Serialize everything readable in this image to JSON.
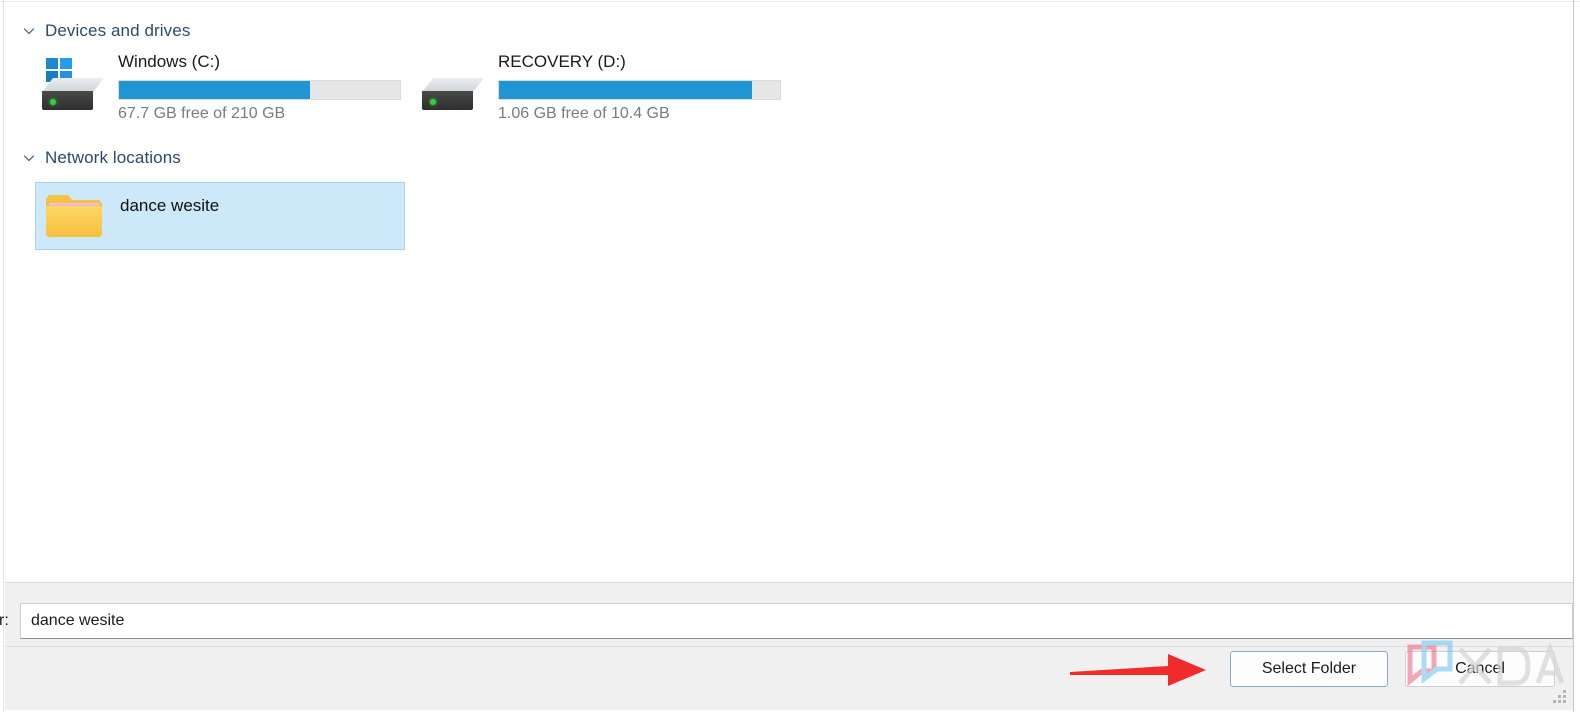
{
  "dialog": {
    "groups": [
      {
        "id": "devices",
        "label": "Devices and drives",
        "chevron_icon": "chevron-down-icon",
        "expanded": true
      },
      {
        "id": "network",
        "label": "Network locations",
        "chevron_icon": "chevron-down-icon",
        "expanded": true
      }
    ],
    "drives": [
      {
        "name": "Windows (C:)",
        "free_text": "67.7 GB free of 210 GB",
        "free_value": "67.7 GB",
        "total_value": "210 GB",
        "used_percent": 68,
        "icon": "windows-drive-icon",
        "bar_fill_color": "#2095d3",
        "bar_track_color": "#e6e6e6"
      },
      {
        "name": "RECOVERY (D:)",
        "free_text": "1.06 GB free of 10.4 GB",
        "free_value": "1.06 GB",
        "total_value": "10.4 GB",
        "used_percent": 90,
        "icon": "hard-drive-icon",
        "bar_fill_color": "#2095d3",
        "bar_track_color": "#e6e6e6"
      }
    ],
    "network_locations": [
      {
        "name": "dance wesite",
        "icon": "folder-with-thumbnail-icon",
        "selected": true,
        "selection_color": "#cde8f8",
        "selection_border_color": "#a8d4ee"
      }
    ],
    "footer": {
      "filename_label": "r:",
      "filename_value": "dance wesite",
      "filename_placeholder": "",
      "buttons": [
        {
          "id": "select-folder",
          "label": "Select Folder",
          "default": true
        },
        {
          "id": "cancel",
          "label": "Cancel",
          "default": false
        }
      ]
    },
    "annotations": {
      "arrow": {
        "color": "#ef2b2b",
        "direction": "right",
        "points_to": "Select Folder"
      },
      "watermark": {
        "text": "XDA",
        "logo_pink": "#f2889f",
        "logo_blue": "#7ec8f0",
        "text_color": "#d8d8d8"
      }
    }
  }
}
